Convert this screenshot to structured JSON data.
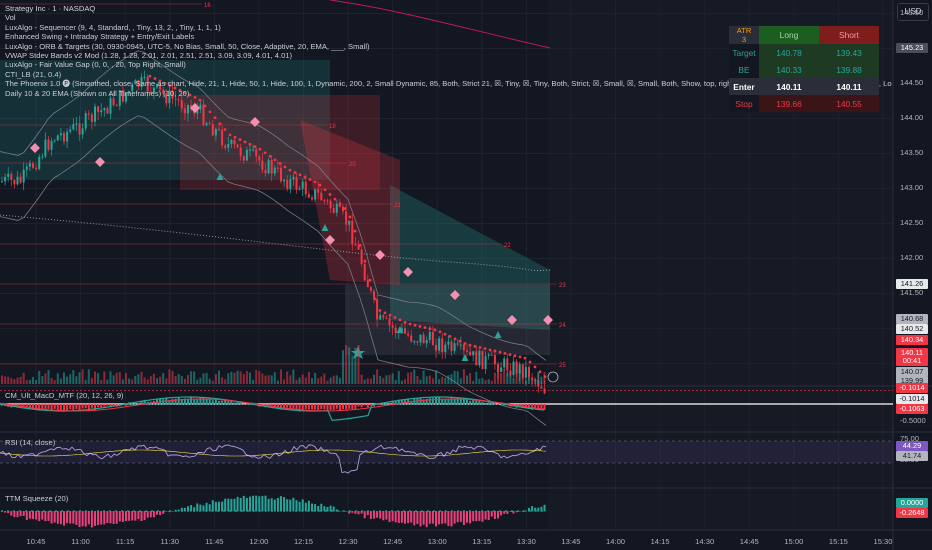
{
  "legend": {
    "title": "Strategy Inc · 1 · NASDAQ",
    "lines": [
      "Vol",
      "LuxAlgo - Sequencer (9, 4, Standard, , Tiny, 13, 2, , Tiny, 1, 1, 1)",
      "Enhanced Swing + Intraday Strategy + Entry/Exit Labels",
      "LuxAlgo - ORB & Targets (30, 0930-0945, UTC-5, No Bias, Small, 50, Close, Adaptive, 20, EMA, ___, Small)",
      "VWAP Stdev Bands v2 Mod (1.28, 1.28, 2.01, 2.01, 2.51, 2.51, 3.09, 3.09, 4.01, 4.01)",
      "LuxAlgo - Fair Value Gap (0, 0, , 20, Top Right, Small)",
      "CTI_LB (21, 0.4)",
      "The Phoenix 1.0 🅟 (Smoothed, close, Same as chart, Hide, 21, 1, Hide, 50, 1, Hide, 100, 1, Dynamic, 200, 2, Small Dynamic, 85, Both, Strict 21, ☒, Tiny, ☒, Tiny, Both, Strict, ☒, Small, ☒, Small, Both, Show, top, right, 1.5, 0.5, 1.5, Text Size, Desktop, Columns, Lo",
      "Daily 10 & 20 EMA (Shown on All Timeframes) (10, 20)"
    ]
  },
  "currency_button": "USD",
  "atr_table": {
    "header": [
      "ATR\n3",
      "Long",
      "Short"
    ],
    "rows": [
      {
        "label": "Target",
        "long": "140.78",
        "short": "139.43",
        "label_color": "#26a69a"
      },
      {
        "label": "BE",
        "long": "140.33",
        "short": "139.88",
        "label_color": "#26a69a"
      },
      {
        "label": "Enter",
        "long": "140.11",
        "short": "140.11",
        "label_color": "#ffffff"
      },
      {
        "label": "Stop",
        "long": "139.66",
        "short": "140.55",
        "label_color": "#f23645"
      }
    ]
  },
  "panes": {
    "macd_label": "CM_Ult_MacD_MTF (20, 12, 26, 9)",
    "rsi_label": "RSI (14, close)",
    "ttm_label": "TTM Squeeze (20)"
  },
  "price_axis": {
    "ticks": [
      "145.50",
      "145.00",
      "144.50",
      "144.00",
      "143.50",
      "143.00",
      "142.50",
      "142.00",
      "141.50",
      "141.00",
      "140.50"
    ],
    "tags": [
      {
        "text": "145.23",
        "bg": "#4a4e59",
        "fg": "#ffffff"
      },
      {
        "text": "141.26",
        "bg": "#e8e9ea",
        "fg": "#131722"
      },
      {
        "text": "140.68",
        "bg": "#b2b5be",
        "fg": "#131722"
      },
      {
        "text": "140.52",
        "bg": "#e8e9ea",
        "fg": "#131722"
      },
      {
        "text": "140.34",
        "bg": "#f23645",
        "fg": "#ffffff"
      },
      {
        "text": "140.11",
        "bg": "#f23645",
        "fg": "#ffffff"
      },
      {
        "text": "00:41",
        "bg": "#f23645",
        "fg": "#ffffff"
      },
      {
        "text": "140.07",
        "bg": "#b2b5be",
        "fg": "#131722"
      },
      {
        "text": "139.99",
        "bg": "#b2b5be",
        "fg": "#131722"
      }
    ]
  },
  "macd_axis": {
    "tags": [
      {
        "text": "-0.1014",
        "bg": "#f23645",
        "fg": "#ffffff"
      },
      {
        "text": "-0.1014",
        "bg": "#e8e9ea",
        "fg": "#131722"
      },
      {
        "text": "-0.1063",
        "bg": "#f23645",
        "fg": "#ffffff"
      }
    ],
    "tick": "-0.5000"
  },
  "rsi_axis": {
    "ticks": [
      "75.00",
      "35.00"
    ],
    "tags": [
      {
        "text": "44.29",
        "bg": "#7e57c2",
        "fg": "#ffffff"
      },
      {
        "text": "41.74",
        "bg": "#b2b5be",
        "fg": "#131722"
      }
    ]
  },
  "ttm_axis": {
    "tags": [
      {
        "text": "0.0000",
        "bg": "#26a69a",
        "fg": "#ffffff"
      },
      {
        "text": "-0.2648",
        "bg": "#f23645",
        "fg": "#ffffff"
      }
    ]
  },
  "chart_data": {
    "type": "candlestick",
    "symbol": "Strategy Inc",
    "interval": "1",
    "exchange": "NASDAQ",
    "x_ticks": [
      "10:45",
      "11:00",
      "11:15",
      "11:30",
      "11:45",
      "12:00",
      "12:15",
      "12:30",
      "12:45",
      "13:00",
      "13:15",
      "13:30",
      "13:45",
      "14:00",
      "14:15",
      "14:30",
      "14:45",
      "15:00",
      "15:15",
      "15:30"
    ],
    "ylim": [
      140.3,
      145.65
    ],
    "approx_close_path": [
      [
        "10:40",
        143.1
      ],
      [
        "10:50",
        143.7
      ],
      [
        "11:00",
        143.9
      ],
      [
        "11:10",
        144.2
      ],
      [
        "11:20",
        144.5
      ],
      [
        "11:30",
        144.3
      ],
      [
        "11:40",
        144.1
      ],
      [
        "11:50",
        143.6
      ],
      [
        "12:00",
        143.4
      ],
      [
        "12:10",
        143.1
      ],
      [
        "12:20",
        142.9
      ],
      [
        "12:30",
        142.5
      ],
      [
        "12:35",
        141.9
      ],
      [
        "12:40",
        141.1
      ],
      [
        "12:50",
        140.9
      ],
      [
        "13:00",
        140.8
      ],
      [
        "13:10",
        140.6
      ],
      [
        "13:20",
        140.5
      ],
      [
        "13:30",
        140.4
      ],
      [
        "13:37",
        140.11
      ]
    ],
    "level_labels": [
      "16",
      "19",
      "20",
      "21",
      "22",
      "23",
      "24",
      "25"
    ]
  }
}
